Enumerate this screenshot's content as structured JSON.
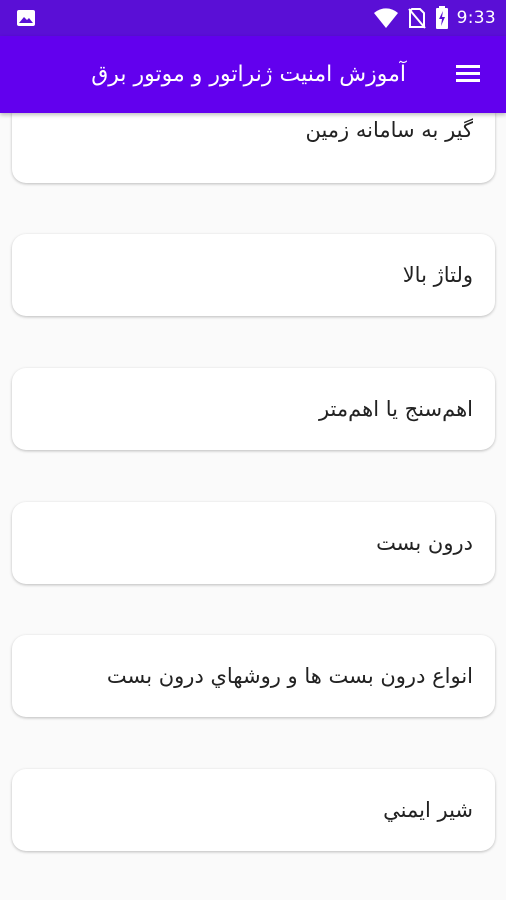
{
  "status_bar": {
    "time": "9:33",
    "icons": [
      "image-notification-icon",
      "wifi-icon",
      "no-sim-icon",
      "battery-charging-icon"
    ]
  },
  "app_bar": {
    "title": "آموزش امنیت ژنراتور و موتور برق",
    "menu_icon": "hamburger-menu-icon"
  },
  "colors": {
    "status_bar": "#5a0fd6",
    "app_bar": "#6200ee",
    "background": "#fafafa",
    "card": "#ffffff"
  },
  "items": [
    {
      "label": "گير به سامانه زمين"
    },
    {
      "label": "ولتاژ بالا"
    },
    {
      "label": "اهم‌سنج يا اهم‌متر"
    },
    {
      "label": "درون بست"
    },
    {
      "label": "انواع درون بست ها و روشهاي درون بست"
    },
    {
      "label": "شير ايمني"
    }
  ]
}
